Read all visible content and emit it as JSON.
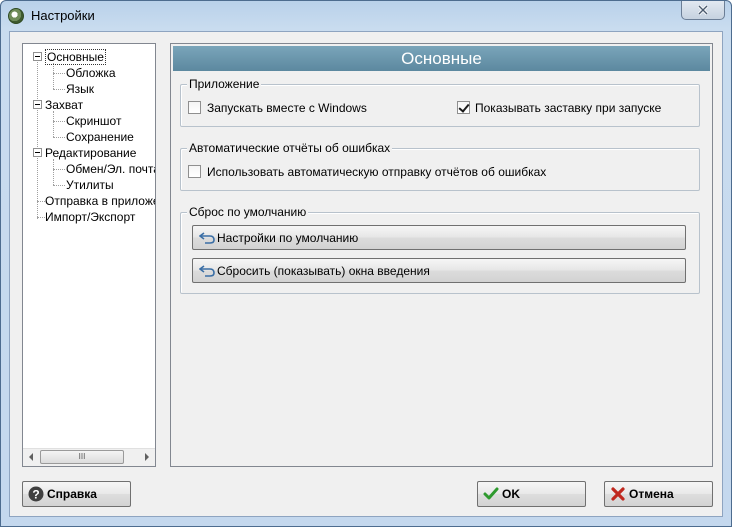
{
  "window": {
    "title": "Настройки"
  },
  "tree": {
    "items": [
      {
        "label": "Основные"
      },
      {
        "label": "Обложка"
      },
      {
        "label": "Язык"
      },
      {
        "label": "Захват"
      },
      {
        "label": "Скриншот"
      },
      {
        "label": "Сохранение"
      },
      {
        "label": "Редактирование"
      },
      {
        "label": "Обмен/Эл. почта"
      },
      {
        "label": "Утилиты"
      },
      {
        "label": "Отправка в приложе"
      },
      {
        "label": "Импорт/Экспорт"
      }
    ],
    "scroll_thumb_label": "III"
  },
  "panel": {
    "title": "Основные",
    "app_group": {
      "title": "Приложение",
      "autostart_label": "Запускать вместе с Windows",
      "autostart_checked": false,
      "splash_label": "Показывать заставку при запуске",
      "splash_checked": true
    },
    "errors_group": {
      "title": "Автоматические отчёты об ошибках",
      "auto_report_label": "Использовать автоматическую отправку отчётов об ошибках",
      "auto_report_checked": false
    },
    "reset_group": {
      "title": "Сброс по умолчанию",
      "defaults_button": "Настройки по умолчанию",
      "intro_button": "Сбросить (показывать) окна введения"
    }
  },
  "footer": {
    "help_label": "Справка",
    "ok_label": "OK",
    "cancel_label": "Отмена"
  }
}
